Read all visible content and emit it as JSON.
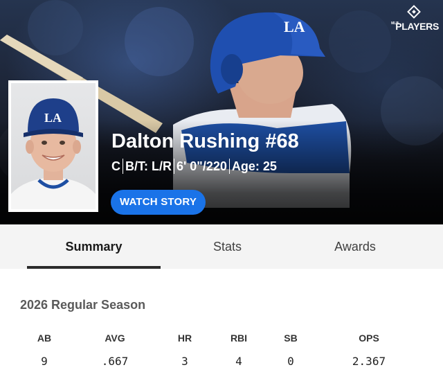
{
  "brand": {
    "logo_text": "PLAYERS",
    "logo_small": "MLB"
  },
  "player": {
    "name_line": "Dalton Rushing #68",
    "position": "C",
    "bats_throws": "B/T: L/R",
    "height_weight": "6' 0\"/220",
    "age": "Age: 25",
    "cap_logo": "LA"
  },
  "actions": {
    "watch_story": "WATCH STORY"
  },
  "tabs": [
    {
      "label": "Summary",
      "active": true
    },
    {
      "label": "Stats",
      "active": false
    },
    {
      "label": "Awards",
      "active": false
    }
  ],
  "season": {
    "title": "2026 Regular Season",
    "headers": [
      "AB",
      "AVG",
      "HR",
      "RBI",
      "SB",
      "OPS"
    ],
    "values": [
      "9",
      ".667",
      "3",
      "4",
      "0",
      "2.367"
    ]
  },
  "colors": {
    "accent_blue": "#1a73e8",
    "team_blue": "#1e4fa3",
    "hero_dark": "#141822"
  }
}
